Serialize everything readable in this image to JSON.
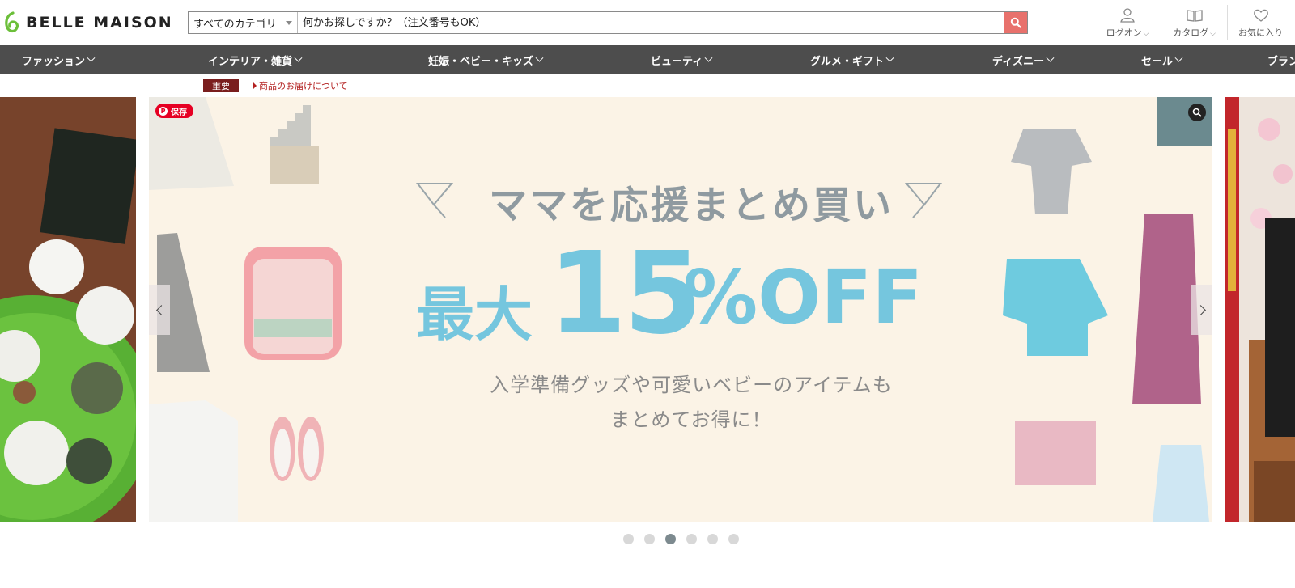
{
  "header": {
    "logo_text": "BELLE MAISON",
    "search": {
      "category": "すべてのカテゴリ",
      "placeholder": "何かお探しですか？（注文番号もOK）"
    },
    "tools": [
      {
        "label": "ログオン",
        "icon": "user-icon"
      },
      {
        "label": "カタログ",
        "icon": "book-icon"
      },
      {
        "label": "お気に入り",
        "icon": "heart-icon"
      }
    ]
  },
  "nav": [
    {
      "label": "ファッション"
    },
    {
      "label": "インテリア・雑貨"
    },
    {
      "label": "妊娠・ベビー・キッズ"
    },
    {
      "label": "ビューティ"
    },
    {
      "label": "グルメ・ギフト"
    },
    {
      "label": "ディズニー"
    },
    {
      "label": "セール"
    },
    {
      "label": "ブラン"
    }
  ],
  "notice": {
    "badge": "重要",
    "link": "商品のお届けについて"
  },
  "banner": {
    "save_label": "保存",
    "headline": "ママを応援まとめ買い",
    "off_prefix": "最大",
    "off_number": "15",
    "off_suffix": "%OFF",
    "sub_line1": "入学準備グッズや可愛いベビーのアイテムも",
    "sub_line2": "まとめてお得に！"
  },
  "carousel": {
    "total_dots": 6,
    "active_dot": 3
  },
  "colors": {
    "nav_bg": "#4d4d4d",
    "search_button": "#e8716c",
    "logo_green": "#6cbf3a",
    "banner_accent": "#75c6de",
    "banner_bg": "#fbf3e6",
    "notice_badge": "#7a1e1e"
  }
}
